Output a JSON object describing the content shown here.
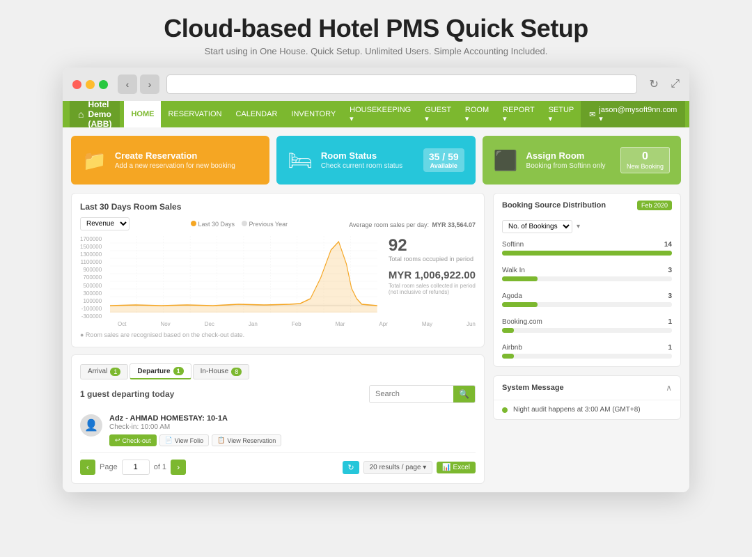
{
  "page": {
    "title": "Cloud-based Hotel PMS Quick Setup",
    "subtitle": "Start using in One House. Quick Setup. Unlimited Users. Simple Accounting Included."
  },
  "browser": {
    "back_label": "‹",
    "forward_label": "›",
    "refresh_label": "↻",
    "expand_label": "⤢"
  },
  "nav": {
    "brand": "Hotel Demo (ABB)",
    "home_icon": "⌂",
    "items": [
      {
        "label": "HOME",
        "active": true
      },
      {
        "label": "RESERVATION",
        "active": false
      },
      {
        "label": "CALENDAR",
        "active": false
      },
      {
        "label": "INVENTORY",
        "active": false
      },
      {
        "label": "HOUSEKEEPING ▾",
        "active": false
      },
      {
        "label": "GUEST ▾",
        "active": false
      },
      {
        "label": "ROOM ▾",
        "active": false
      },
      {
        "label": "REPORT ▾",
        "active": false
      },
      {
        "label": "SETUP ▾",
        "active": false
      }
    ],
    "user_email": "jason@mysoft9nn.com ▾",
    "user_icon": "✉"
  },
  "dashboard_cards": [
    {
      "id": "create-reservation",
      "icon": "📁",
      "title": "Create Reservation",
      "subtitle": "Add a new reservation for new booking",
      "type": "orange"
    },
    {
      "id": "room-status",
      "icon": "🛏",
      "title": "Room Status",
      "subtitle": "Check current room status",
      "badge_top": "35 / 59",
      "badge_bot": "Available",
      "type": "teal"
    },
    {
      "id": "assign-room",
      "icon": "⬛",
      "title": "Assign Room",
      "subtitle": "Booking from Softinn only",
      "action_label": "0\nNew Booking",
      "type": "green"
    }
  ],
  "chart": {
    "title": "Last 30 Days Room Sales",
    "select_label": "Revenue",
    "legend_30": "Last 30 Days",
    "legend_prev": "Previous Year",
    "avg_label": "Average room sales per day:",
    "avg_value": "MYR 33,564.07",
    "stat1_value": "92",
    "stat1_label": "Total rooms occupied in period",
    "stat2_value": "MYR 1,006,922.00",
    "stat2_label": "Total room sales collected in period\n(not inclusive of refunds)",
    "note": "● Room sales are recognised based on the check-out date.",
    "y_labels": [
      "1700000",
      "1500000",
      "1300000",
      "1100000",
      "900000",
      "700000",
      "500000",
      "300000",
      "100000",
      "-100000",
      "-300000"
    ]
  },
  "tabs": [
    {
      "label": "Arrival",
      "badge": "1",
      "active": false
    },
    {
      "label": "Departure",
      "badge": "1",
      "active": true
    },
    {
      "label": "In-House",
      "badge": "8",
      "active": false
    }
  ],
  "guest_section": {
    "count_label": "1 guest departing today",
    "search_placeholder": "Search",
    "search_icon": "🔍"
  },
  "guests": [
    {
      "name": "Adz - AHMAD HOMESTAY: 10-1A",
      "meta": "Check-in: 10:00 AM",
      "checkout_label": "Check-out",
      "folio_label": "View Folio",
      "reservation_label": "View Reservation",
      "avatar_icon": "👤"
    }
  ],
  "pagination": {
    "prev_label": "‹",
    "next_label": "›",
    "page_label": "Page",
    "page_value": "1",
    "of_label": "of 1",
    "refresh_icon": "↻",
    "results_label": "20 results / page ▾",
    "excel_label": "Excel",
    "excel_icon": "📊"
  },
  "booking_source": {
    "title": "Booking Source Distribution",
    "badge": "Feb 2020",
    "select_label": "No. of Bookings",
    "sources": [
      {
        "name": "Softinn",
        "count": 14,
        "max": 14
      },
      {
        "name": "Walk In",
        "count": 3,
        "max": 14
      },
      {
        "name": "Agoda",
        "count": 3,
        "max": 14
      },
      {
        "name": "Booking.com",
        "count": 1,
        "max": 14
      },
      {
        "name": "Airbnb",
        "count": 1,
        "max": 14
      }
    ]
  },
  "system_message": {
    "title": "System Message",
    "collapse_icon": "∧",
    "message": "Night audit happens at 3:00 AM (GMT+8)",
    "dot_color": "#7cb82f"
  }
}
